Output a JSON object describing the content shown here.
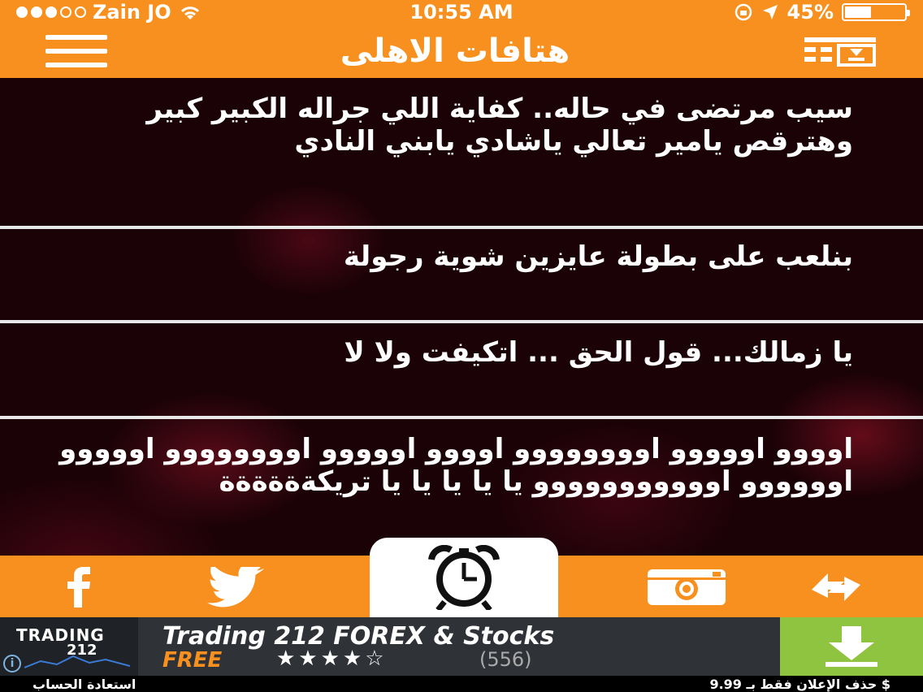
{
  "status_bar": {
    "carrier": "Zain JO",
    "time": "10:55 AM",
    "battery_percent": "45%",
    "battery_level": 0.45
  },
  "nav": {
    "title": "هتافات الاهلى"
  },
  "quotes": [
    {
      "text": "سيب مرتضى في حاله.. كفاية اللي جراله الكبير كبير وهترقص يامير تعالي ياشادي يابني النادي"
    },
    {
      "text": "بنلعب على بطولة عايزين شوية رجولة"
    },
    {
      "text": "يا زمالك... قول الحق ... اتكيفت ولا لا"
    },
    {
      "text": "اوووو اووووو اوووووووو اوووو اووووو اوووووووو اووووو اوووووو اووووووووووو يا يا يا يا يا تريكةةةةةة"
    }
  ],
  "toolbar": {
    "facebook_icon": "facebook-icon",
    "twitter_icon": "twitter-icon",
    "alarm_icon": "alarm-clock-icon",
    "instagram_icon": "instagram-icon",
    "share_icon": "share-icon"
  },
  "ad": {
    "logo_line1": "TRADING",
    "logo_line2": "212",
    "title": "Trading 212 FOREX & Stocks",
    "free_label": "FREE",
    "rating": 3.5,
    "stars": "★★★★☆",
    "review_count": "(556)",
    "info_label": "i"
  },
  "footer": {
    "restore_label": "استعادة الحساب",
    "remove_ads_label": "حذف الإعلان فقط بـ 9.99 $"
  },
  "colors": {
    "accent": "#f7901e",
    "ad_download": "#8fc441"
  }
}
